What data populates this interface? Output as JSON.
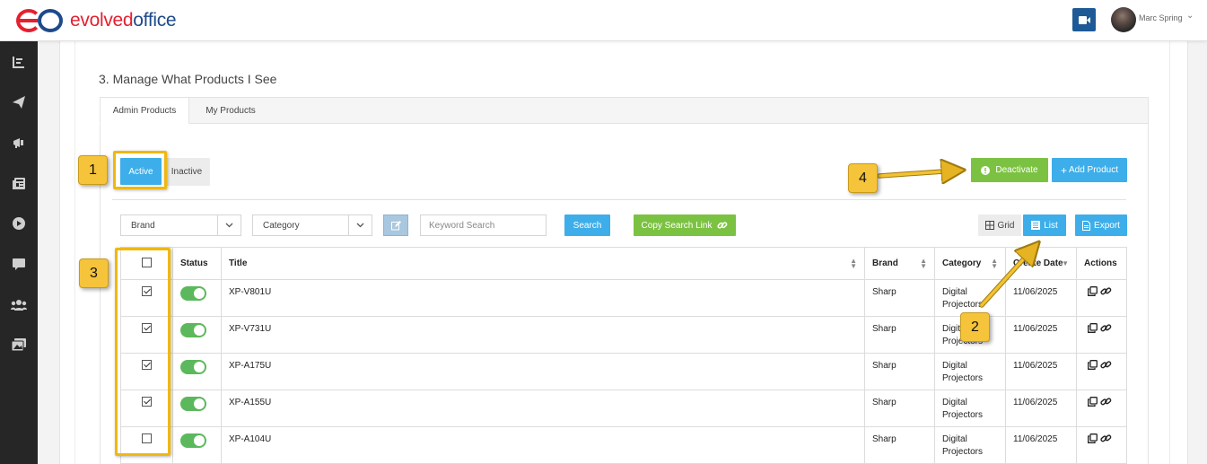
{
  "header": {
    "logo_part1": "evolved",
    "logo_part2": "office",
    "user_name": "Marc Spring"
  },
  "sidebar": {
    "icons": [
      "dashboard-icon",
      "send-icon",
      "megaphone-icon",
      "newspaper-icon",
      "play-icon",
      "chat-icon",
      "users-icon",
      "gallery-icon"
    ]
  },
  "page": {
    "section_title": "3. Manage What Products I See",
    "tabs": [
      {
        "label": "Admin Products",
        "active": true
      },
      {
        "label": "My Products",
        "active": false
      }
    ],
    "status_buttons": {
      "active": "Active",
      "inactive": "Inactive"
    },
    "deactivate_label": "Deactivate",
    "add_product_label": "Add Product",
    "filters": {
      "brand": "Brand",
      "category": "Category",
      "keyword_placeholder": "Keyword Search",
      "search_label": "Search",
      "copy_link_label": "Copy Search Link"
    },
    "views": {
      "grid": "Grid",
      "list": "List",
      "export": "Export"
    }
  },
  "table": {
    "columns": [
      "Status",
      "Title",
      "Brand",
      "Category",
      "Create Date",
      "Actions"
    ],
    "rows": [
      {
        "checked": true,
        "status_on": true,
        "title": "XP-V801U",
        "brand": "Sharp",
        "category": "Digital Projectors",
        "date": "11/06/2025"
      },
      {
        "checked": true,
        "status_on": true,
        "title": "XP-V731U",
        "brand": "Sharp",
        "category": "Digital Projectors",
        "date": "11/06/2025"
      },
      {
        "checked": true,
        "status_on": true,
        "title": "XP-A175U",
        "brand": "Sharp",
        "category": "Digital Projectors",
        "date": "11/06/2025"
      },
      {
        "checked": true,
        "status_on": true,
        "title": "XP-A155U",
        "brand": "Sharp",
        "category": "Digital Projectors",
        "date": "11/06/2025"
      },
      {
        "checked": false,
        "status_on": true,
        "title": "XP-A104U",
        "brand": "Sharp",
        "category": "Digital Projectors",
        "date": "11/06/2025"
      }
    ]
  },
  "annotations": [
    "1",
    "2",
    "3",
    "4"
  ],
  "colors": {
    "brand_red": "#e5202f",
    "brand_blue": "#1e4a8a",
    "accent_blue": "#3daee9",
    "accent_green": "#7cc242",
    "callout_yellow": "#f6c43a"
  }
}
